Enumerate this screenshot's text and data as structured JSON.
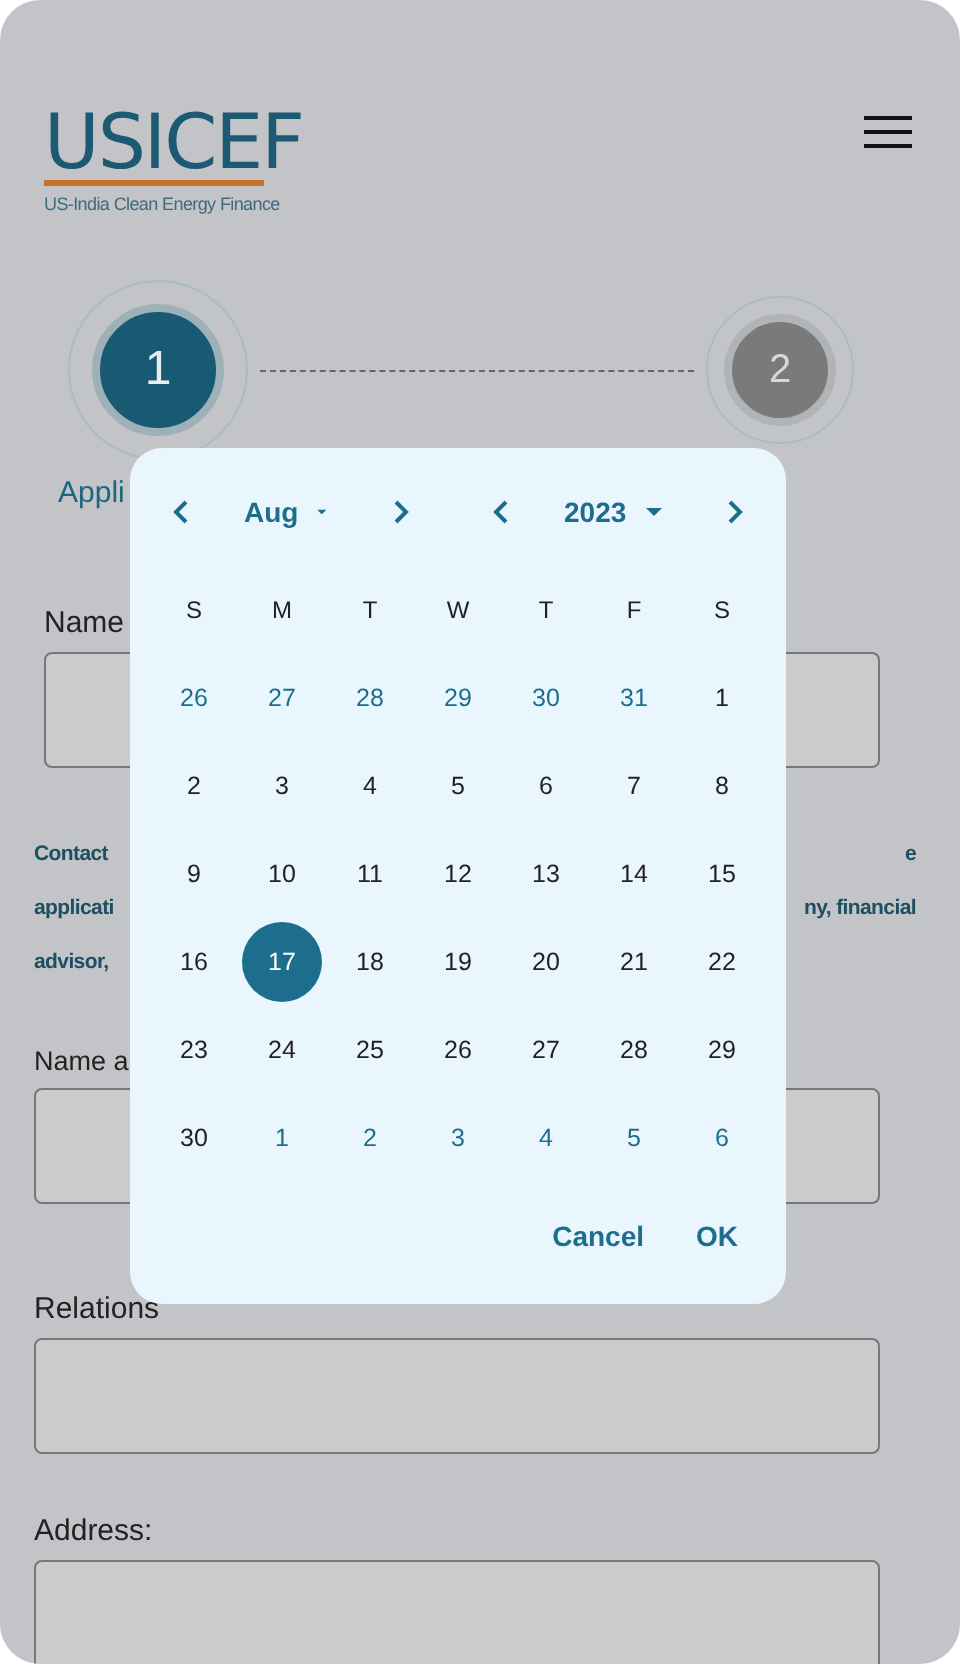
{
  "header": {
    "logo_title": "USICEF",
    "logo_tagline": "US-India Clean Energy Finance"
  },
  "steps": [
    {
      "number": "1",
      "label": "Appli",
      "selected": true
    },
    {
      "number": "2",
      "selected": false
    }
  ],
  "form": [
    {
      "kind": "field",
      "label": "Name"
    },
    {
      "kind": "note",
      "lines": [
        {
          "left": "Contact",
          "right": "e"
        },
        {
          "left": "applicati",
          "right": "ny, financial"
        },
        {
          "left": "advisor,"
        }
      ]
    },
    {
      "kind": "field",
      "label": "Name a"
    },
    {
      "kind": "field",
      "label": "Relations"
    },
    {
      "kind": "field",
      "label": "Address:"
    }
  ],
  "date_picker": {
    "month": "Aug",
    "year": "2023",
    "weekdays": [
      "S",
      "M",
      "T",
      "W",
      "T",
      "F",
      "S"
    ],
    "days": [
      {
        "label": "26",
        "kind": "other_month",
        "selected": false
      },
      {
        "label": "27",
        "kind": "other_month",
        "selected": false
      },
      {
        "label": "28",
        "kind": "other_month",
        "selected": false
      },
      {
        "label": "29",
        "kind": "other_month",
        "selected": false
      },
      {
        "label": "30",
        "kind": "other_month",
        "selected": false
      },
      {
        "label": "31",
        "kind": "other_month",
        "selected": false
      },
      {
        "label": "1",
        "kind": "day",
        "selected": false
      },
      {
        "label": "2",
        "kind": "day",
        "selected": false
      },
      {
        "label": "3",
        "kind": "day",
        "selected": false
      },
      {
        "label": "4",
        "kind": "day",
        "selected": false
      },
      {
        "label": "5",
        "kind": "day",
        "selected": false
      },
      {
        "label": "6",
        "kind": "day",
        "selected": false
      },
      {
        "label": "7",
        "kind": "day",
        "selected": false
      },
      {
        "label": "8",
        "kind": "day",
        "selected": false
      },
      {
        "label": "9",
        "kind": "day",
        "selected": false
      },
      {
        "label": "10",
        "kind": "day",
        "selected": false
      },
      {
        "label": "11",
        "kind": "day",
        "selected": false
      },
      {
        "label": "12",
        "kind": "day",
        "selected": false
      },
      {
        "label": "13",
        "kind": "day",
        "selected": false
      },
      {
        "label": "14",
        "kind": "day",
        "selected": false
      },
      {
        "label": "15",
        "kind": "day",
        "selected": false
      },
      {
        "label": "16",
        "kind": "day",
        "selected": false
      },
      {
        "label": "17",
        "kind": "day",
        "selected": true
      },
      {
        "label": "18",
        "kind": "day",
        "selected": false
      },
      {
        "label": "19",
        "kind": "day",
        "selected": false
      },
      {
        "label": "20",
        "kind": "day",
        "selected": false
      },
      {
        "label": "21",
        "kind": "day",
        "selected": false
      },
      {
        "label": "22",
        "kind": "day",
        "selected": false
      },
      {
        "label": "23",
        "kind": "day",
        "selected": false
      },
      {
        "label": "24",
        "kind": "day",
        "selected": false
      },
      {
        "label": "25",
        "kind": "day",
        "selected": false
      },
      {
        "label": "26",
        "kind": "day",
        "selected": false
      },
      {
        "label": "27",
        "kind": "day",
        "selected": false
      },
      {
        "label": "28",
        "kind": "day",
        "selected": false
      },
      {
        "label": "29",
        "kind": "day",
        "selected": false
      },
      {
        "label": "30",
        "kind": "day",
        "selected": false
      },
      {
        "label": "1",
        "kind": "other_month",
        "selected": false
      },
      {
        "label": "2",
        "kind": "other_month",
        "selected": false
      },
      {
        "label": "3",
        "kind": "other_month",
        "selected": false
      },
      {
        "label": "4",
        "kind": "other_month",
        "selected": false
      },
      {
        "label": "5",
        "kind": "other_month",
        "selected": false
      },
      {
        "label": "6",
        "kind": "other_month",
        "selected": false
      }
    ],
    "buttons": [
      "Cancel",
      "OK"
    ]
  }
}
